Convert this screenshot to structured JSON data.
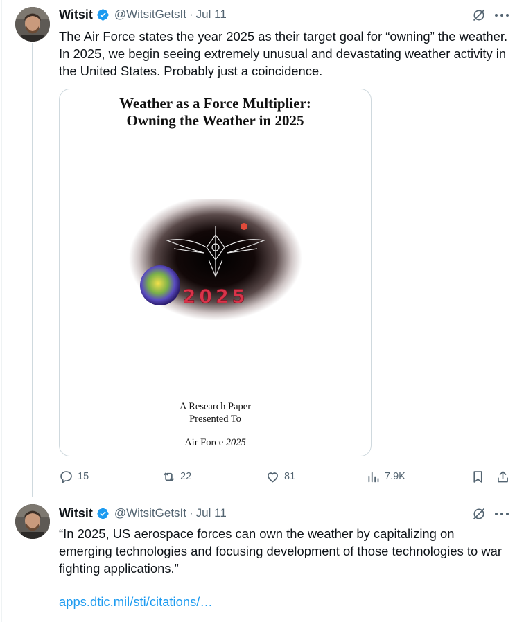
{
  "tweets": [
    {
      "author": {
        "name": "Witsit",
        "handle": "@WitsitGetsIt",
        "verified": true
      },
      "separator": "·",
      "date": "Jul 11",
      "text": "The Air Force states the year 2025 as their target goal for “owning” the weather. In 2025, we begin seeing extremely unusual and devastating weather activity in the United States. Probably just a coincidence.",
      "media": {
        "title_line1": "Weather as a Force Multiplier:",
        "title_line2": "Owning the Weather in 2025",
        "emblem_text": "2025",
        "paper_line1": "A Research Paper",
        "paper_line2": "Presented To",
        "paper_line3_prefix": "Air Force",
        "paper_line3_year": "2025"
      },
      "stats": {
        "replies": "15",
        "reposts": "22",
        "likes": "81",
        "views": "7.9K"
      }
    },
    {
      "author": {
        "name": "Witsit",
        "handle": "@WitsitGetsIt",
        "verified": true
      },
      "separator": "·",
      "date": "Jul 11",
      "text": "“In 2025, US aerospace forces can own the weather by capitalizing on emerging technologies and focusing development of those technologies to war fighting applications.”",
      "link": "apps.dtic.mil/sti/citations/…"
    }
  ],
  "icons": [
    "verified-badge-icon",
    "grok-icon",
    "more-icon",
    "reply-icon",
    "repost-icon",
    "like-icon",
    "views-icon",
    "bookmark-icon",
    "share-icon"
  ],
  "colors": {
    "accent": "#1d9bf0",
    "secondary_text": "#536471",
    "primary_text": "#0f1419",
    "border": "#cfd9de"
  }
}
